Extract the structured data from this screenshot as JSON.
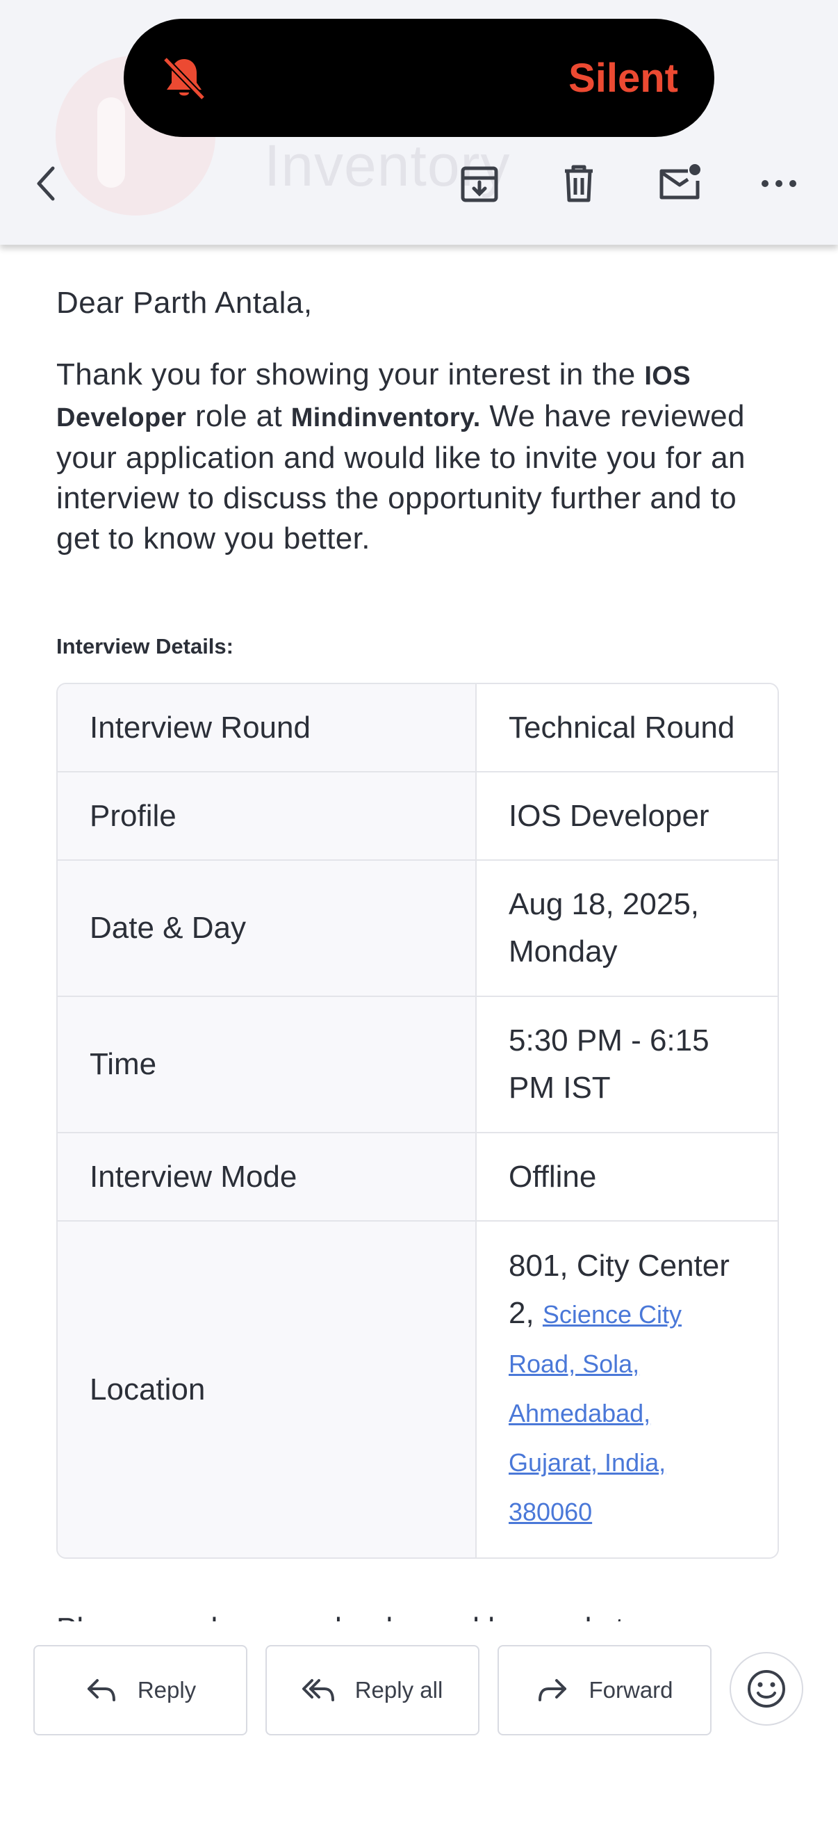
{
  "status_pill": {
    "label": "Silent"
  },
  "toolbar": {
    "watermark_text": "Inventory",
    "icons": [
      "back-icon",
      "archive-icon",
      "trash-icon",
      "mark-unread-icon",
      "more-icon"
    ]
  },
  "email": {
    "greeting": "Dear Parth Antala,",
    "intro_1": "Thank you for showing your interest in the ",
    "role": "IOS Developer",
    "intro_2": " role at ",
    "company": "Mindinventory.",
    "intro_3": " We have reviewed your application and would like to invite you for an interview to discuss the opportunity further and to get to know you better.",
    "details_title": "Interview Details:",
    "details": [
      {
        "label": "Interview Round",
        "value": "Technical Round"
      },
      {
        "label": "Profile",
        "value": "IOS Developer"
      },
      {
        "label": "Date & Day",
        "value": "Aug 18, 2025, Monday"
      },
      {
        "label": "Time",
        "value": "5:30 PM - 6:15 PM IST"
      },
      {
        "label": "Interview Mode",
        "value": "Offline"
      },
      {
        "label": "Location",
        "value_prefix": "801, City Center 2, ",
        "value_link": "Science City Road, Sola, Ahmedabad, Gujarat, India, 380060"
      }
    ],
    "cut_text": "Please mark your calendar and be ready to"
  },
  "actions": {
    "reply": "Reply",
    "reply_all": "Reply all",
    "forward": "Forward"
  },
  "colors": {
    "silent_accent": "#ec4a32",
    "link": "#4a78d8"
  }
}
